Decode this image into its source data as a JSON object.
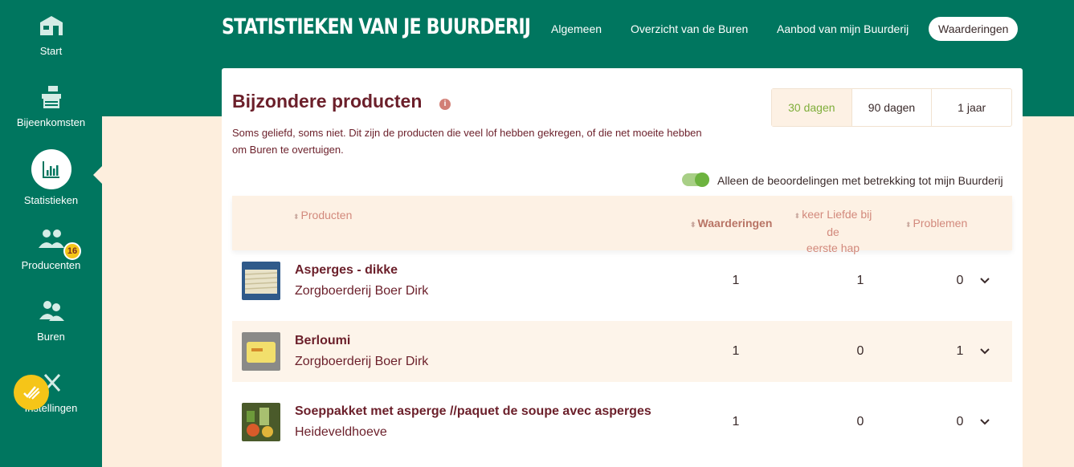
{
  "sidebar": {
    "items": [
      {
        "label": "Start",
        "icon": "barn-icon"
      },
      {
        "label": "Bijeenkomsten",
        "icon": "market-stall-icon"
      },
      {
        "label": "Statistieken",
        "icon": "bar-chart-icon"
      },
      {
        "label": "Producenten",
        "icon": "producers-icon",
        "badge": "16"
      },
      {
        "label": "Buren",
        "icon": "people-icon"
      },
      {
        "label": "Instellingen",
        "icon": "tools-icon"
      }
    ],
    "active": "Statistieken"
  },
  "header": {
    "brand": "STATISTIEKEN VAN JE BUURDERIJ",
    "nav": [
      "Algemeen",
      "Overzicht van de Buren",
      "Aanbod van mijn Buurderij",
      "Waarderingen"
    ],
    "active_nav": "Waarderingen"
  },
  "section": {
    "title": "Bijzondere producten",
    "description": "Soms geliefd, soms niet. Dit zijn de producten die veel lof hebben gekregen, of die net moeite hebben om Buren te overtuigen.",
    "periods": [
      "30 dagen",
      "90 dagen",
      "1 jaar"
    ],
    "active_period": "30 dagen",
    "toggle_label": "Alleen de beoordelingen met betrekking tot mijn Buurderij",
    "toggle_on": true
  },
  "table": {
    "headers": {
      "product": "Producten",
      "ratings": "Waarderingen",
      "love_line1": "keer Liefde bij de",
      "love_line2": "eerste hap",
      "problems": "Problemen"
    },
    "rows": [
      {
        "name": "Asperges - dikke",
        "farm": "Zorgboerderij Boer Dirk",
        "ratings": "1",
        "love": "1",
        "problems": "0"
      },
      {
        "name": "Berloumi",
        "farm": "Zorgboerderij Boer Dirk",
        "ratings": "1",
        "love": "0",
        "problems": "1"
      },
      {
        "name": "Soeppakket met asperge //paquet de soupe avec asperges",
        "farm": "Heideveldhoeve",
        "ratings": "1",
        "love": "0",
        "problems": "0"
      }
    ]
  },
  "colors": {
    "primary_green": "#00765f",
    "accent_burgundy": "#6b1f2a",
    "cream": "#fdeedd",
    "badge_yellow": "#f5c518",
    "active_period_green": "#7fae3a"
  }
}
